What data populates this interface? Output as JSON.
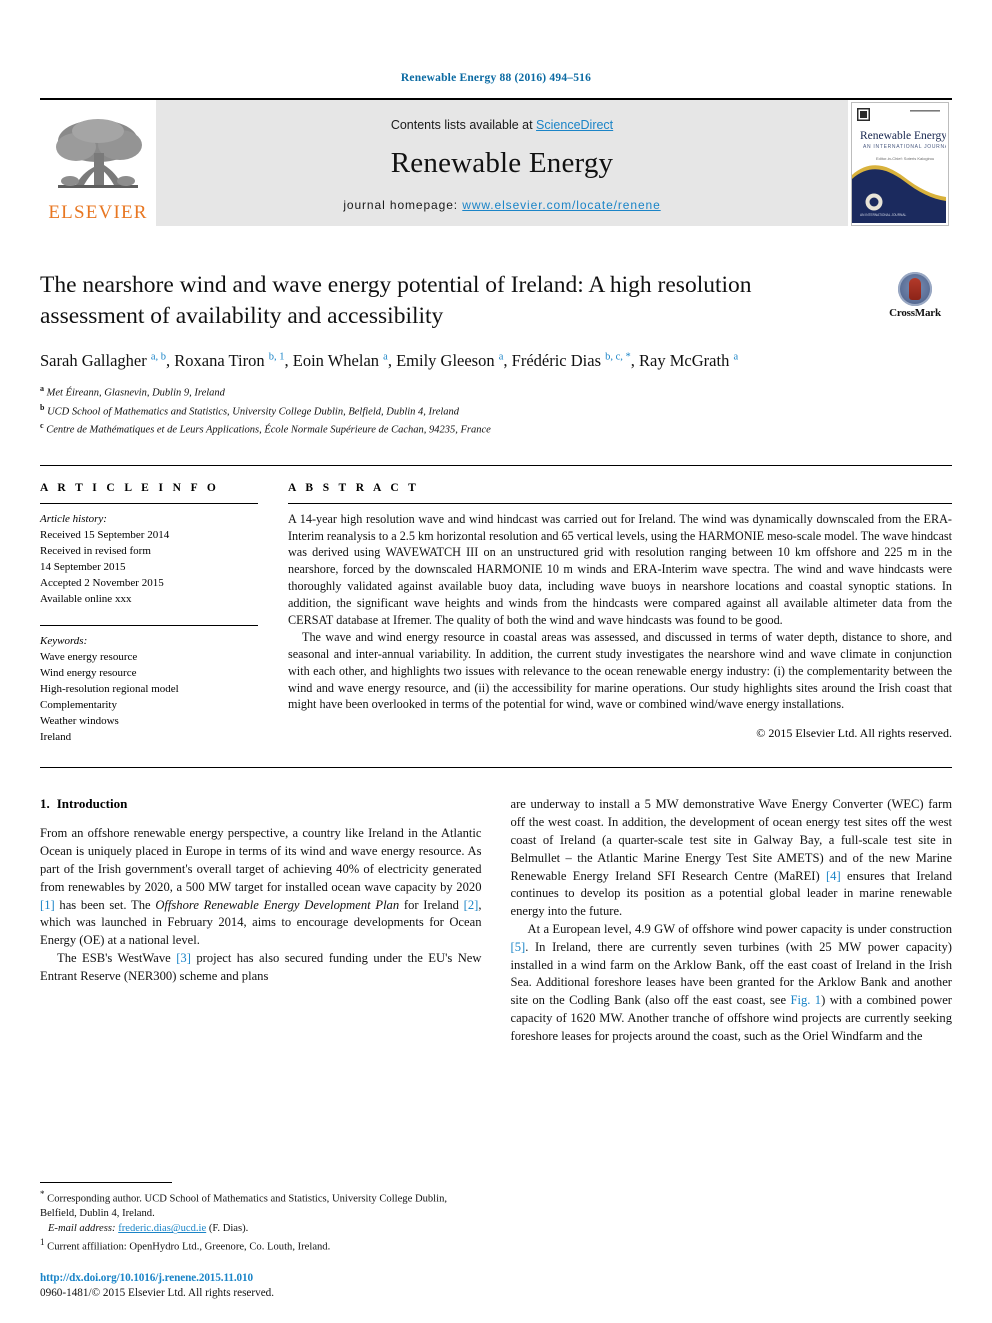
{
  "running_head": "Renewable Energy 88 (2016) 494–516",
  "banner": {
    "publisher_logo_text": "ELSEVIER",
    "contents_prefix": "Contents lists available at ",
    "contents_link": "ScienceDirect",
    "journal_name": "Renewable Energy",
    "homepage_prefix": "journal homepage: ",
    "homepage_url": "www.elsevier.com/locate/renene",
    "cover": {
      "title": "Renewable Energy",
      "subtitle": "AN INTERNATIONAL JOURNAL",
      "editor_line": "Editor-in-Chief: Soteris Kalogirou"
    }
  },
  "article": {
    "title": "The nearshore wind and wave energy potential of Ireland: A high resolution assessment of availability and accessibility",
    "crossmark_label": "CrossMark",
    "authors_html": "Sarah Gallagher <sup>a, b</sup>, Roxana Tiron <sup>b, 1</sup>, Eoin Whelan <sup>a</sup>, Emily Gleeson <sup>a</sup>, Frédéric Dias <sup>b, c, *</sup>, Ray McGrath <sup>a</sup>",
    "affiliations": [
      {
        "mark": "a",
        "text": "Met Éireann, Glasnevin, Dublin 9, Ireland"
      },
      {
        "mark": "b",
        "text": "UCD School of Mathematics and Statistics, University College Dublin, Belfield, Dublin 4, Ireland"
      },
      {
        "mark": "c",
        "text": "Centre de Mathématiques et de Leurs Applications, École Normale Supérieure de Cachan, 94235, France"
      }
    ]
  },
  "article_info": {
    "heading": "A R T I C L E   I N F O",
    "history_label": "Article history:",
    "history": [
      "Received 15 September 2014",
      "Received in revised form",
      "14 September 2015",
      "Accepted 2 November 2015",
      "Available online xxx"
    ],
    "keywords_label": "Keywords:",
    "keywords": [
      "Wave energy resource",
      "Wind energy resource",
      "High-resolution regional model",
      "Complementarity",
      "Weather windows",
      "Ireland"
    ]
  },
  "abstract": {
    "heading": "A B S T R A C T",
    "paragraphs": [
      "A 14-year high resolution wave and wind hindcast was carried out for Ireland. The wind was dynamically downscaled from the ERA-Interim reanalysis to a 2.5 km horizontal resolution and 65 vertical levels, using the HARMONIE meso-scale model. The wave hindcast was derived using WAVEWATCH III on an unstructured grid with resolution ranging between 10 km offshore and 225 m in the nearshore, forced by the downscaled HARMONIE 10 m winds and ERA-Interim wave spectra. The wind and wave hindcasts were thoroughly validated against available buoy data, including wave buoys in nearshore locations and coastal synoptic stations. In addition, the significant wave heights and winds from the hindcasts were compared against all available altimeter data from the CERSAT database at Ifremer. The quality of both the wind and wave hindcasts was found to be good.",
      "The wave and wind energy resource in coastal areas was assessed, and discussed in terms of water depth, distance to shore, and seasonal and inter-annual variability. In addition, the current study investigates the nearshore wind and wave climate in conjunction with each other, and highlights two issues with relevance to the ocean renewable energy industry: (i) the complementarity between the wind and wave energy resource, and (ii) the accessibility for marine operations. Our study highlights sites around the Irish coast that might have been overlooked in terms of the potential for wind, wave or combined wind/wave energy installations."
    ],
    "copyright": "© 2015 Elsevier Ltd. All rights reserved."
  },
  "body": {
    "section_number": "1.",
    "section_title": "Introduction",
    "left_paragraph_1_html": "From an offshore renewable energy perspective, a country like Ireland in the Atlantic Ocean is uniquely placed in Europe in terms of its wind and wave energy resource. As part of the Irish government's overall target of achieving 40% of electricity generated from renewables by 2020, a 500 MW target for installed ocean wave capacity by 2020 <span class=\"ref\">[1]</span> has been set. The <span class=\"ital\">Offshore Renewable Energy Development Plan</span> for Ireland <span class=\"ref\">[2]</span>, which was launched in February 2014, aims to encourage developments for Ocean Energy (OE) at a national level.",
    "left_paragraph_2_html": "The ESB's WestWave <span class=\"ref\">[3]</span> project has also secured funding under the EU's New Entrant Reserve (NER300) scheme and plans",
    "right_paragraph_1_html": "are underway to install a 5 MW demonstrative Wave Energy Converter (WEC) farm off the west coast. In addition, the development of ocean energy test sites off the west coast of Ireland (a quarter-scale test site in Galway Bay, a full-scale test site in Belmullet &ndash; the Atlantic Marine Energy Test Site AMETS) and of the new Marine Renewable Energy Ireland SFI Research Centre (MaREI) <span class=\"ref\">[4]</span> ensures that Ireland continues to develop its position as a potential global leader in marine renewable energy into the future.",
    "right_paragraph_2_html": "At a European level, 4.9 GW of offshore wind power capacity is under construction <span class=\"ref\">[5]</span>. In Ireland, there are currently seven turbines (with 25 MW power capacity) installed in a wind farm on the Arklow Bank, off the east coast of Ireland in the Irish Sea. Additional foreshore leases have been granted for the Arklow Bank and another site on the Codling Bank (also off the east coast, see <span class=\"ref\">Fig. 1</span>) with a combined power capacity of 1620 MW. Another tranche of offshore wind projects are currently seeking foreshore leases for projects around the coast, such as the Oriel Windfarm and the"
  },
  "footnotes": {
    "corresponding_html": "<span class=\"marker\">*</span> Corresponding author. UCD School of Mathematics and Statistics, University College Dublin, Belfield, Dublin 4, Ireland.",
    "email_label": "E-mail address:",
    "email": "frederic.dias@ucd.ie",
    "email_suffix": "(F. Dias).",
    "current_affiliation_html": "<span class=\"marker\">1</span> Current affiliation: OpenHydro Ltd., Greenore, Co. Louth, Ireland.",
    "doi": "http://dx.doi.org/10.1016/j.renene.2015.11.010",
    "issn_line": "0960-1481/© 2015 Elsevier Ltd. All rights reserved."
  },
  "colors": {
    "link": "#1a84c7",
    "elsevier_orange": "#e87722",
    "banner_gray": "#e6e6e6",
    "cover_navy": "#1b2a5e",
    "cover_gold": "#d9b23c"
  }
}
